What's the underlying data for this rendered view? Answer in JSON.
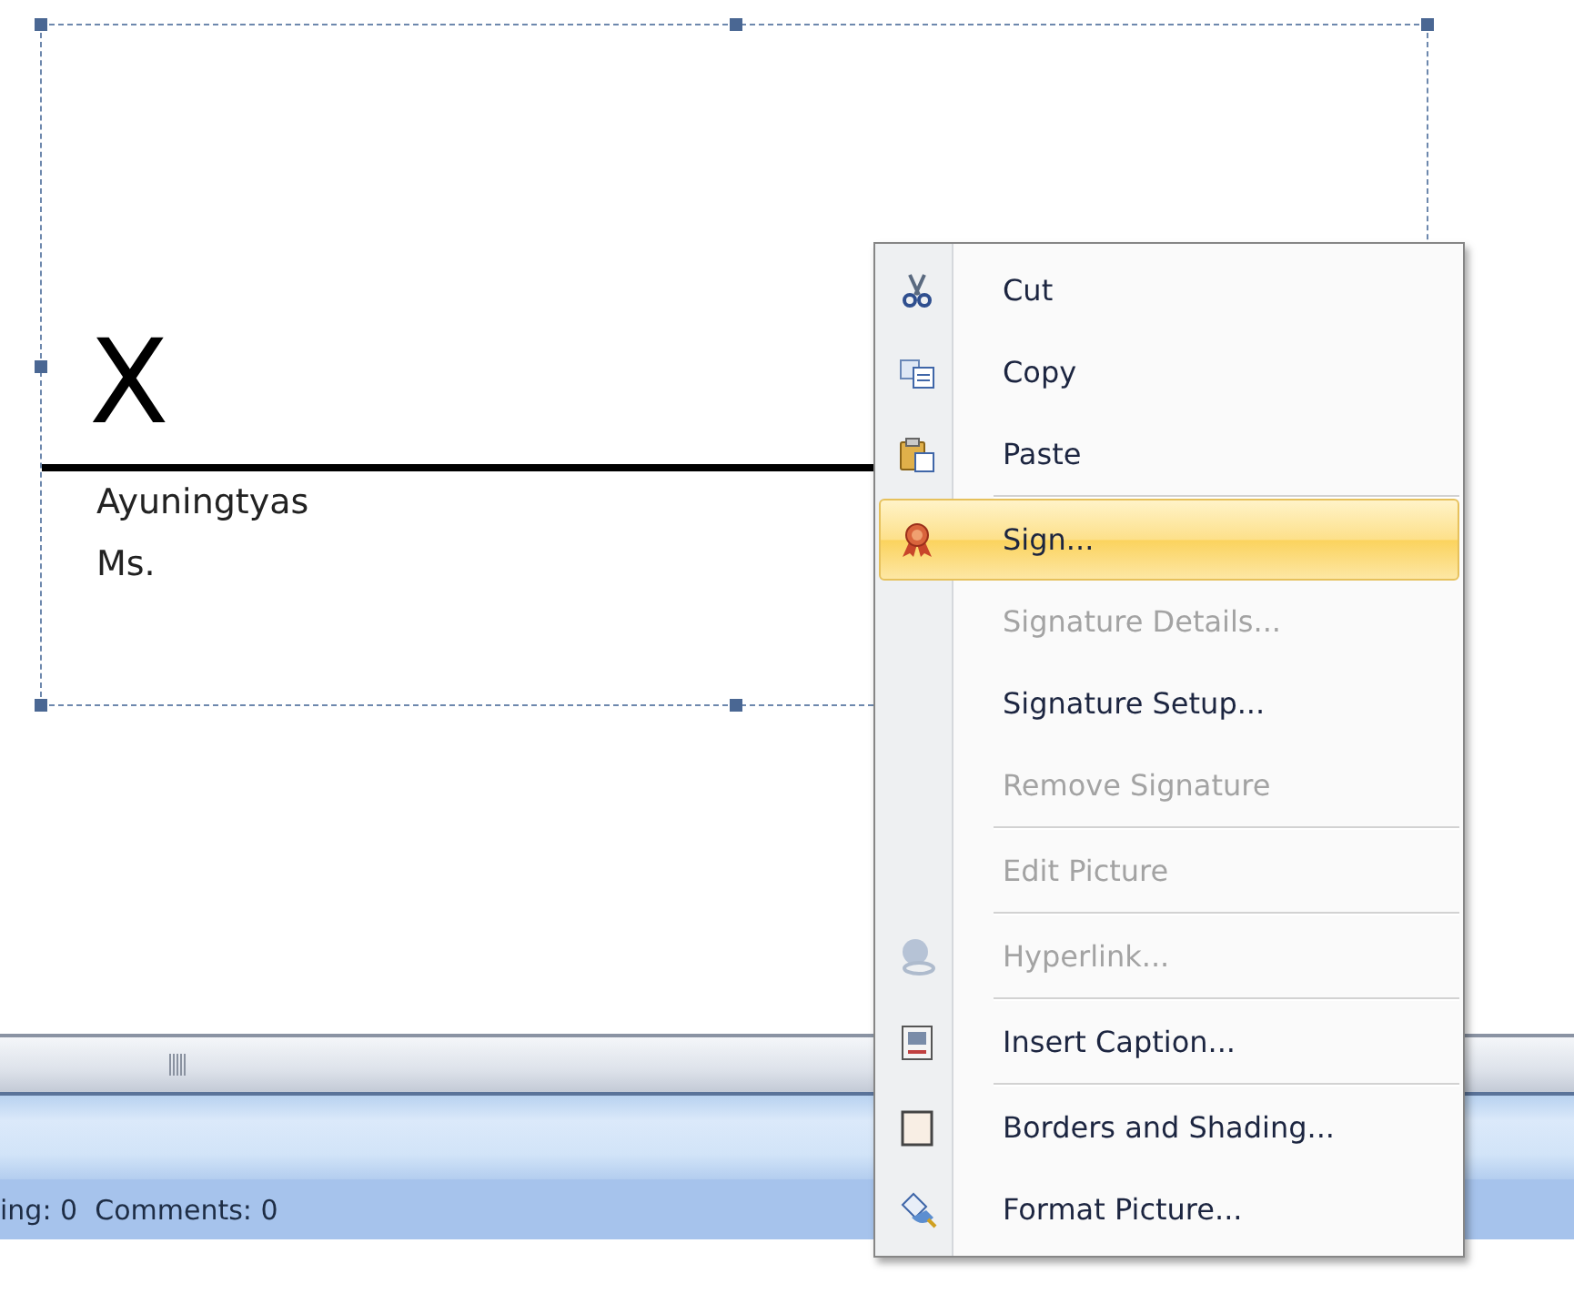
{
  "signature": {
    "mark": "X",
    "name": "Ayuningtyas",
    "title": "Ms.",
    "selected": true
  },
  "context_menu": {
    "groups": [
      [
        {
          "label": "Cut",
          "disabled": false,
          "selected": false
        },
        {
          "label": "Copy",
          "disabled": false,
          "selected": false
        },
        {
          "label": "Paste",
          "disabled": false,
          "selected": false
        }
      ],
      [
        {
          "label": "Sign...",
          "disabled": false,
          "selected": true
        },
        {
          "label": "Signature Details...",
          "disabled": true,
          "selected": false
        },
        {
          "label": "Signature Setup...",
          "disabled": false,
          "selected": false
        },
        {
          "label": "Remove Signature",
          "disabled": true,
          "selected": false
        }
      ],
      [
        {
          "label": "Edit Picture",
          "disabled": true,
          "selected": false
        }
      ],
      [
        {
          "label": "Hyperlink...",
          "disabled": true,
          "selected": false
        }
      ],
      [
        {
          "label": "Insert Caption...",
          "disabled": false,
          "selected": false
        }
      ],
      [
        {
          "label": "Borders and Shading...",
          "disabled": false,
          "selected": false
        },
        {
          "label": "Format Picture...",
          "disabled": false,
          "selected": false
        }
      ]
    ]
  },
  "status_bar": {
    "text": "ing: 0  Comments: 0"
  }
}
